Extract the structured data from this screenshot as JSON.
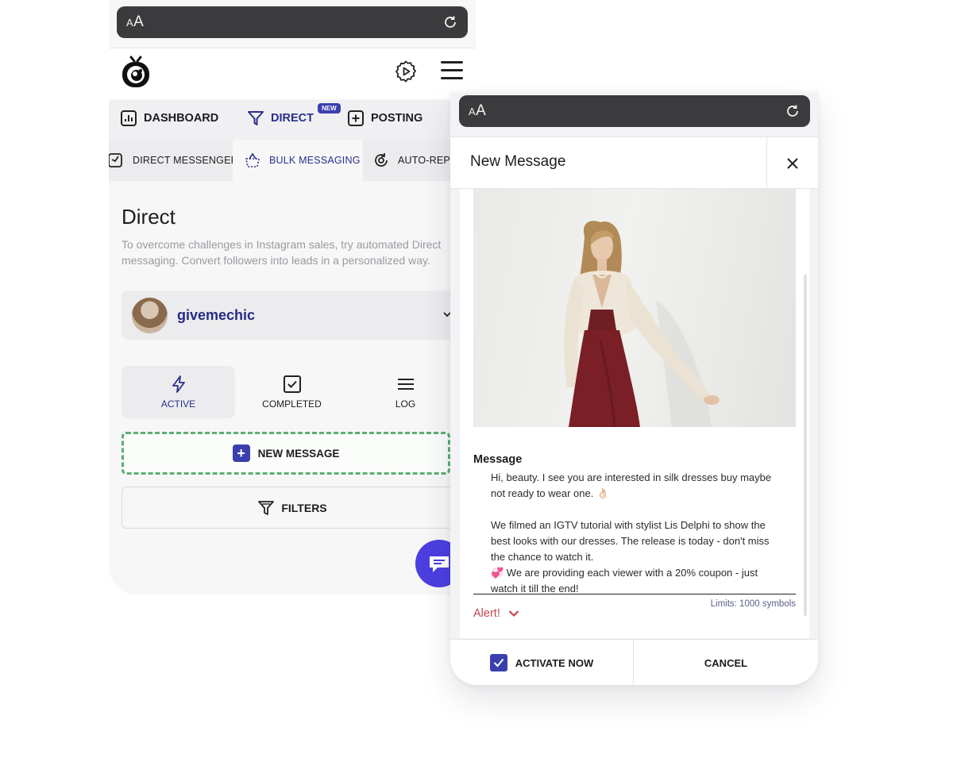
{
  "colors": {
    "accent": "#2a2f8a",
    "primary_button": "#3a3fae",
    "dashed_border": "#5aaf73",
    "alert": "#c2464e",
    "fab": "#4b3fe0"
  },
  "browser": {
    "aa_small": "A",
    "aa_large": "A",
    "reload_icon": "reload-icon"
  },
  "header": {
    "logo_icon": "owl-logo-icon",
    "settings_icon": "gear-play-icon",
    "menu_icon": "hamburger-icon"
  },
  "main_tabs": {
    "dashboard": "DASHBOARD",
    "direct": "DIRECT",
    "direct_badge": "NEW",
    "posting": "POSTING"
  },
  "sub_tabs": {
    "direct_messenger": "DIRECT MESSENGER",
    "bulk_messaging": "BULK MESSAGING",
    "auto_reply": "AUTO-REPL"
  },
  "page": {
    "title": "Direct",
    "description": "To overcome challenges in Instagram sales, try automated Direct messaging. Convert followers into leads in a personalized way."
  },
  "account": {
    "name": "givemechic"
  },
  "status_tabs": {
    "active": "ACTIVE",
    "completed": "COMPLETED",
    "log": "LOG"
  },
  "actions": {
    "new_message": "NEW MESSAGE",
    "new_message_plus": "+",
    "filters": "FILTERS"
  },
  "modal": {
    "title": "New Message",
    "message_label": "Message",
    "message_lines": [
      "Hi, beauty. I see you are interested in silk dresses buy maybe not ready to wear one. 👌🏻",
      "",
      "We filmed an IGTV tutorial with stylist Lis Delphi to show the best looks with our dresses. The release is today - don't miss the chance to watch it.",
      "💞 We are providing each viewer with a 20% coupon - just watch it till the end!"
    ],
    "limits": "Limits: 1000 symbols",
    "alert": "Alert!",
    "activate": "ACTIVATE NOW",
    "activate_checked": true,
    "cancel": "CANCEL"
  }
}
